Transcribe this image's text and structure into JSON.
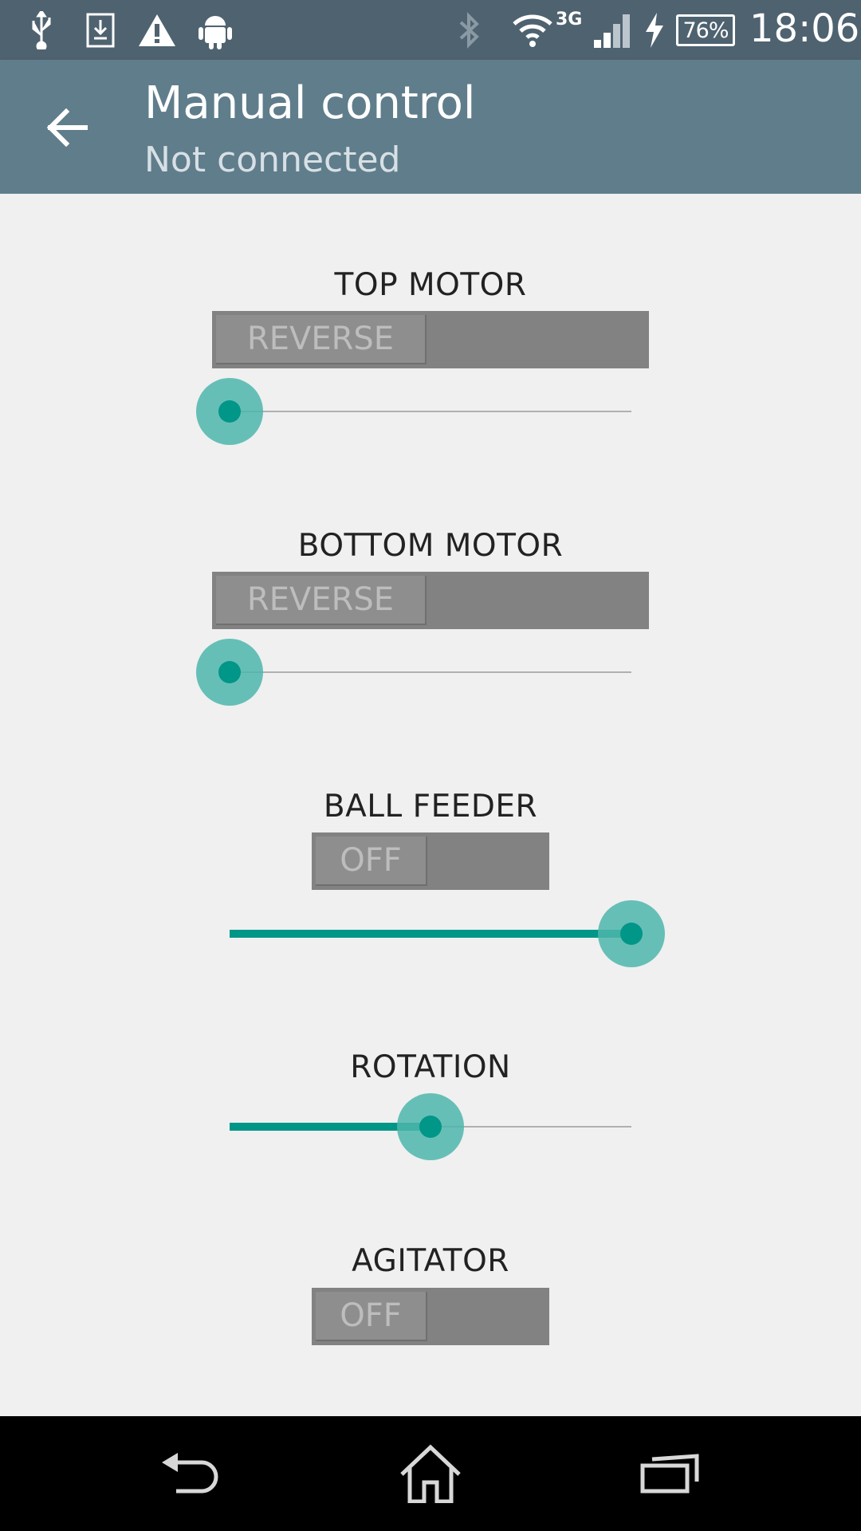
{
  "status_bar": {
    "icons": [
      "usb-icon",
      "download-icon",
      "warning-icon",
      "android-icon",
      "bluetooth-icon",
      "wifi-icon",
      "signal-icon",
      "charging-icon",
      "battery-icon"
    ],
    "network_type": "3G",
    "battery": "76%",
    "time": "18:06"
  },
  "action_bar": {
    "title": "Manual control",
    "subtitle": "Not connected"
  },
  "controls": [
    {
      "label": "TOP MOTOR",
      "toggle": "REVERSE",
      "slider_value": 0.0
    },
    {
      "label": "BOTTOM MOTOR",
      "toggle": "REVERSE",
      "slider_value": 0.0
    },
    {
      "label": "BALL FEEDER",
      "toggle": "OFF",
      "slider_value": 1.0
    },
    {
      "label": "ROTATION",
      "slider_value": 0.5
    },
    {
      "label": "AGITATOR",
      "toggle": "OFF"
    }
  ],
  "colors": {
    "accent": "#009688",
    "action_bar": "#607d8b",
    "status_bar": "#4f6270"
  }
}
